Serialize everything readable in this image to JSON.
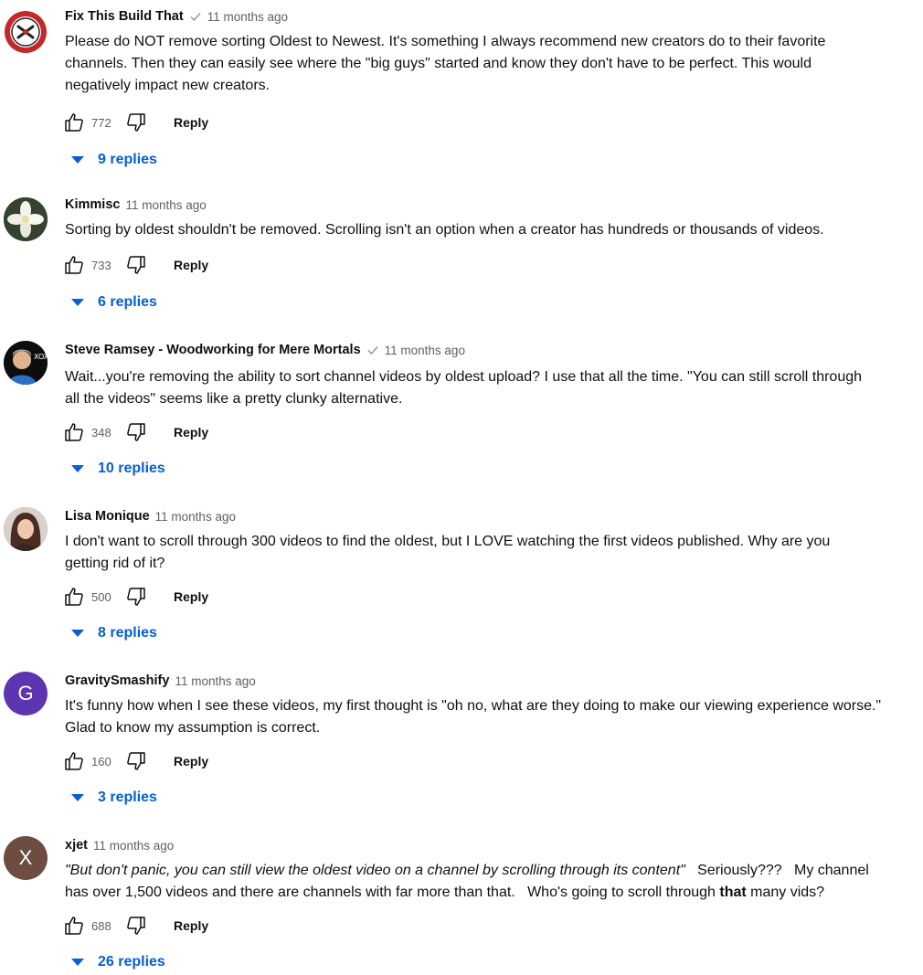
{
  "comments": [
    {
      "author": "Fix This Build That",
      "verified": true,
      "time": "11 months ago",
      "text_lines": [
        "Please do NOT remove sorting Oldest to Newest.  It's something I always recommend new creators do to their favorite",
        "channels.  Then they can easily see where the \"big guys\" started and know they don't have to be perfect.  This would",
        "negatively impact new creators."
      ],
      "likes": "772",
      "reply_label": "Reply",
      "replies_label": "9 replies",
      "avatar": {
        "kind": "logo",
        "color": "#c62828"
      }
    },
    {
      "author": "Kimmisc",
      "verified": false,
      "time": "11 months ago",
      "text_lines": [
        "Sorting by oldest shouldn't be removed. Scrolling isn't an option when a creator has hundreds or thousands of videos."
      ],
      "likes": "733",
      "reply_label": "Reply",
      "replies_label": "6 replies",
      "avatar": {
        "kind": "flower",
        "color": "#2e3b2a"
      }
    },
    {
      "author": "Steve Ramsey - Woodworking for Mere Mortals",
      "verified": true,
      "time": "11 months ago",
      "text_lines": [
        "Wait...you're removing the ability to sort channel videos by oldest upload? I use that all the time. \"You can still scroll through",
        "all the videos\" seems like a pretty clunky alternative."
      ],
      "likes": "348",
      "reply_label": "Reply",
      "replies_label": "10 replies",
      "avatar": {
        "kind": "photo",
        "color": "#1e5aa8"
      }
    },
    {
      "author": "Lisa Monique",
      "verified": false,
      "time": "11 months ago",
      "text_lines": [
        "I don't want to scroll through 300 videos to find the oldest, but I LOVE watching the first videos published.  Why are you",
        "getting rid of it?"
      ],
      "likes": "500",
      "reply_label": "Reply",
      "replies_label": "8 replies",
      "avatar": {
        "kind": "photo",
        "color": "#6b4a3a"
      }
    },
    {
      "author": "GravitySmashify",
      "verified": false,
      "time": "11 months ago",
      "text_lines": [
        "It's funny how when I see these videos, my first thought is \"oh no, what are they doing to make our viewing experience worse.\"",
        "Glad to know my assumption is correct."
      ],
      "likes": "160",
      "reply_label": "Reply",
      "replies_label": "3 replies",
      "avatar": {
        "kind": "letter",
        "letter": "G",
        "color": "#5e35b1"
      }
    },
    {
      "author": "xjet",
      "verified": false,
      "time": "11 months ago",
      "rich": {
        "italic": "\"But don't panic, you can still view the oldest video on a channel by scrolling through its content\"",
        "after_italic": "   Seriously???   My channel",
        "line2_before": "has over 1,500 videos and there are channels with far more than that.   Who's going to scroll through ",
        "bold": "that",
        "line2_after": " many vids?"
      },
      "likes": "688",
      "reply_label": "Reply",
      "replies_label": "26 replies",
      "avatar": {
        "kind": "letter",
        "letter": "X",
        "color": "#6d4c41"
      }
    }
  ]
}
